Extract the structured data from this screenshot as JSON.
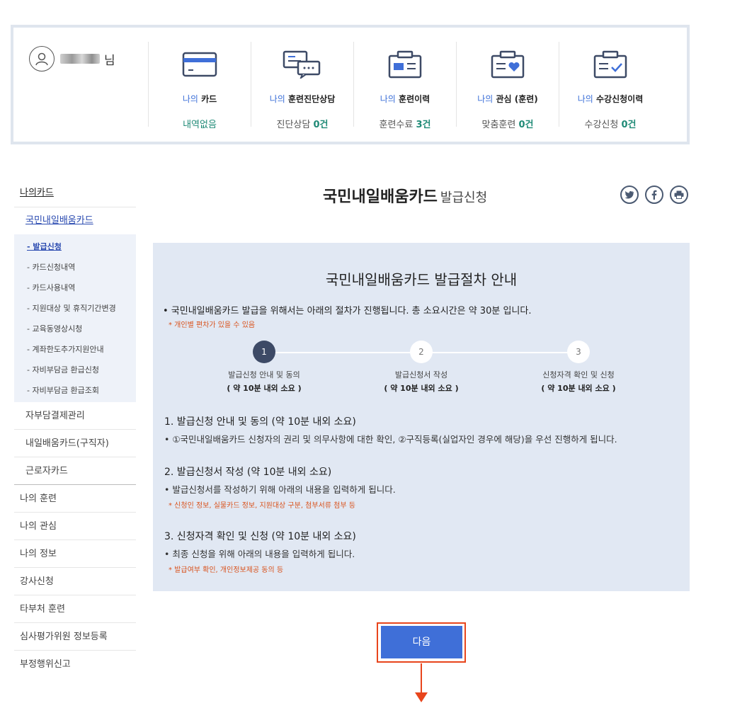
{
  "user": {
    "suffix": "님"
  },
  "summary": [
    {
      "icon": "card-icon",
      "prefix": "나의",
      "title": "카드",
      "value_text": "내역없음",
      "value_num": ""
    },
    {
      "icon": "chat-consult-icon",
      "prefix": "나의",
      "title": "훈련진단상담",
      "value_text": "진단상담",
      "value_num": "0건"
    },
    {
      "icon": "id-card-icon",
      "prefix": "나의",
      "title": "훈련이력",
      "value_text": "훈련수료",
      "value_num": "3건"
    },
    {
      "icon": "heart-folder-icon",
      "prefix": "나의",
      "title": "관심 (훈련)",
      "value_text": "맞춤훈련",
      "value_num": "0건"
    },
    {
      "icon": "check-folder-icon",
      "prefix": "나의",
      "title": "수강신청이력",
      "value_text": "수강신청",
      "value_num": "0건"
    }
  ],
  "sidebar": {
    "head": "나의카드",
    "sub": "국민내일배움카드",
    "items": [
      "- 발급신청",
      "- 카드신청내역",
      "- 카드사용내역",
      "- 지원대상 및 휴직기간변경",
      "- 교육동영상시청",
      "- 계좌한도추가지원안내",
      "- 자비부담금 환급신청",
      "- 자비부담금 환급조회"
    ],
    "sub_rows": [
      "자부담결제관리",
      "내일배움카드(구직자)",
      "근로자카드"
    ],
    "rows": [
      "나의 훈련",
      "나의 관심",
      "나의 정보",
      "강사신청",
      "타부처 훈련",
      "심사평가위원 정보등록",
      "부정행위신고"
    ]
  },
  "page": {
    "title": "국민내일배움카드",
    "subtitle": "발급신청"
  },
  "share": [
    "twitter-icon",
    "facebook-icon",
    "print-icon"
  ],
  "guide": {
    "title": "국민내일배움카드 발급절차 안내",
    "intro": "• 국민내일배움카드 발급을 위해서는 아래의 절차가 진행됩니다. 총 소요시간은 약 30분 입니다.",
    "note": "* 개인별 편차가 있을 수 있음",
    "steps": [
      {
        "num": "1",
        "label": "발급신청 안내 및 동의",
        "time": "( 약 10분 내외 소요 )"
      },
      {
        "num": "2",
        "label": "발급신청서 작성",
        "time": "( 약 10분 내외 소요 )"
      },
      {
        "num": "3",
        "label": "신청자격 확인 및 신청",
        "time": "( 약 10분 내외 소요 )"
      }
    ],
    "sections": [
      {
        "title": "1. 발급신청 안내 및 동의 (약 10분 내외 소요)",
        "desc": "• ①국민내일배움카드 신청자의 권리 및 의무사항에 대한 확인, ②구직등록(실업자인 경우에 해당)을 우선 진행하게 됩니다.",
        "note": ""
      },
      {
        "title": "2. 발급신청서 작성 (약 10분 내외 소요)",
        "desc": "• 발급신청서를 작성하기 위해 아래의 내용을 입력하게 됩니다.",
        "note": "* 신청인 정보, 실물카드 정보, 지원대상 구분, 첨부서류 첨부 등"
      },
      {
        "title": "3. 신청자격 확인 및 신청 (약 10분 내외 소요)",
        "desc": "• 최종 신청을 위해 아래의 내용을 입력하게 됩니다.",
        "note": "* 발급여부 확인, 개인정보제공 동의 등"
      }
    ]
  },
  "next_button": "다음",
  "colors": {
    "accent_blue": "#3f6fd8",
    "highlight": "#e8451c",
    "teal": "#1f8a76",
    "note_orange": "#d9531e",
    "guide_bg": "#e1e8f3"
  }
}
